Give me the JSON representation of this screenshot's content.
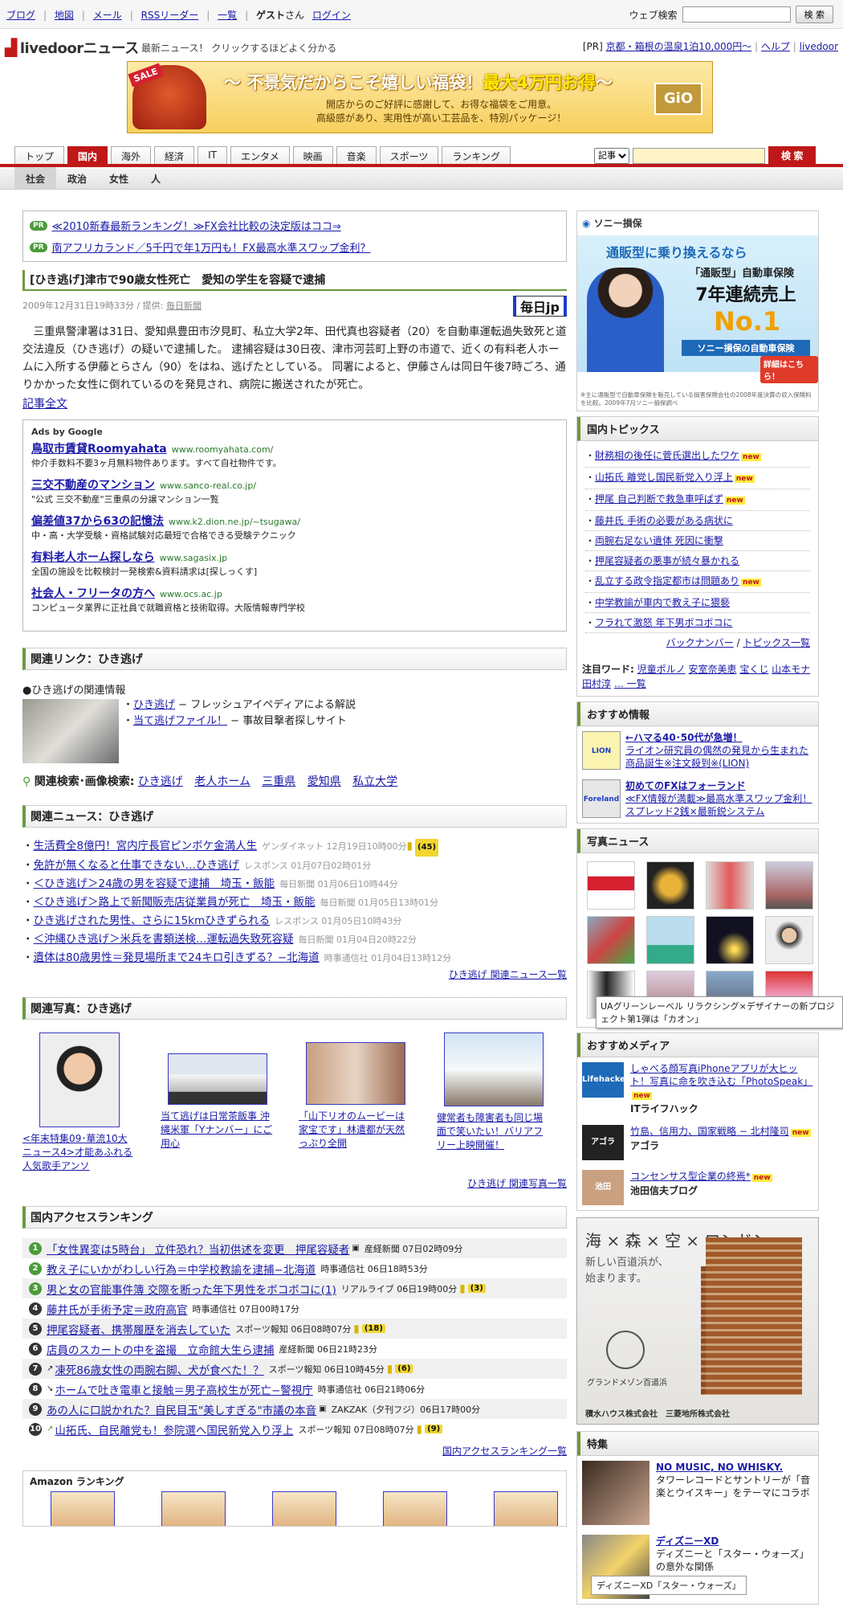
{
  "topbar": {
    "links": [
      "ブログ",
      "地図",
      "メール",
      "RSSリーダー",
      "一覧"
    ],
    "guest": "ゲスト",
    "san": "さん",
    "login": "ログイン",
    "websearch_label": "ウェブ検索",
    "websearch_button": "検 索"
  },
  "brand": {
    "logo": "livedoor",
    "logo_news": "ニュース",
    "tagline": "最新ニュース！ クリックするほどよく分かる",
    "pr_prefix": "[PR]",
    "pr_link": "京都・箱根の温泉1泊10,000円〜",
    "help": "ヘルプ",
    "livedoor": "livedoor"
  },
  "banner": {
    "sale": "SALE",
    "headline_pre": "〜 不景気だからこそ嬉しい福袋！",
    "headline_em": "最大4万円お得",
    "headline_post": "〜",
    "sub1": "開店からのご好評に感謝して、お得な福袋をご用意。",
    "sub2": "高級感があり、実用性が高い工芸品を、特別パッケージ！",
    "brand": "GiO"
  },
  "tabs": [
    "トップ",
    "国内",
    "海外",
    "経済",
    "IT",
    "エンタメ",
    "映画",
    "音楽",
    "スポーツ",
    "ランキング"
  ],
  "active_tab": "国内",
  "search": {
    "select": "記事",
    "button": "検 索"
  },
  "subtabs": [
    "社会",
    "政治",
    "女性",
    "人"
  ],
  "pr_links": [
    "≪2010新春最新ランキング！≫FX会社比較の決定版はココ⇒",
    "南アフリカランド／5千円で年1万円も！FX最高水準スワップ金利？"
  ],
  "pr_tag": "PR",
  "article": {
    "title": "[ひき逃げ]津市で90歳女性死亡　愛知の学生を容疑で逮捕",
    "date": "2009年12月31日19時33分 / 提供:",
    "provider": "毎日新聞",
    "logo": "毎日jp",
    "body": "三重県警津署は31日、愛知県豊田市汐見町、私立大学2年、田代真也容疑者（20）を自動車運転過失致死と道交法違反（ひき逃げ）の疑いで逮捕した。 逮捕容疑は30日夜、津市河芸町上野の市道で、近くの有料老人ホームに入所する伊藤とらさん（90）をはね、逃げたとしている。 同署によると、伊藤さんは同日午後7時ごろ、通りかかった女性に倒れているのを発見され、病院に搬送されたが死亡。",
    "more": "記事全文"
  },
  "ads": {
    "heading": "Ads by Google",
    "items": [
      {
        "title": "鳥取市賃貸Roomyahata",
        "url": "www.roomyahata.com/",
        "desc": "仲介手数料不要3ヶ月無料物件あります。すべて自社物件です。"
      },
      {
        "title": "三交不動産のマンション",
        "url": "www.sanco-real.co.jp/",
        "desc": "\"公式 三交不動産\"三重県の分譲マンション一覧"
      },
      {
        "title": "偏差値37から63の記憶法",
        "url": "www.k2.dion.ne.jp/~tsugawa/",
        "desc": "中・高・大学受験・資格試験対応最短で合格できる受験テクニック"
      },
      {
        "title": "有料老人ホーム探しなら",
        "url": "www.sagasix.jp",
        "desc": "全国の施設を比較検討一発検索&資料請求は[探しっくす]"
      },
      {
        "title": "社会人・フリータの方へ",
        "url": "www.ocs.ac.jp",
        "desc": "コンピュータ業界に正社員で就職資格と技術取得。大阪情報専門学校"
      }
    ]
  },
  "related_links": {
    "heading": "関連リンク：ひき逃げ",
    "info_title": "●ひき逃げの関連情報",
    "items": [
      {
        "link": "ひき逃げ",
        "desc": " − フレッシュアイペディアによる解説"
      },
      {
        "link": "当て逃げファイル！",
        "desc": " − 事故目撃者探しサイト"
      }
    ]
  },
  "keyword_search": {
    "label": "関連検索･画像検索:",
    "words": [
      "ひき逃げ",
      "老人ホーム",
      "三重県",
      "愛知県",
      "私立大学"
    ]
  },
  "related_news": {
    "heading": "関連ニュース：ひき逃げ",
    "items": [
      {
        "title": "生活費全8億円！宮内庁長官ピンボケ金満人生",
        "src": "ゲンダイネット 12月19日10時00分",
        "cmt": "(45)"
      },
      {
        "title": "免許が無くなると仕事できない…ひき逃げ",
        "src": "レスポンス 01月07日02時01分",
        "cmt": ""
      },
      {
        "title": "＜ひき逃げ＞24歳の男を容疑で逮捕　埼玉・飯能",
        "src": "毎日新聞 01月06日10時44分",
        "cmt": ""
      },
      {
        "title": "＜ひき逃げ＞路上で新聞販売店従業員が死亡　埼玉・飯能",
        "src": "毎日新聞 01月05日13時01分",
        "cmt": ""
      },
      {
        "title": "ひき逃げされた男性、さらに15kmひきずられる",
        "src": "レスポンス 01月05日10時43分",
        "cmt": ""
      },
      {
        "title": "＜沖縄ひき逃げ＞米兵を書類送検…運転過失致死容疑",
        "src": "毎日新聞 01月04日20時22分",
        "cmt": ""
      },
      {
        "title": "遺体は80歳男性＝発見場所まで24キロ引きずる？−北海道",
        "src": "時事通信社 01月04日13時12分",
        "cmt": ""
      }
    ],
    "more": "ひき逃げ 関連ニュース一覧"
  },
  "related_photos": {
    "heading": "関連写真：ひき逃げ",
    "items": [
      "<年末特集09･華流10大ニュース4>才能あふれる人気歌手アンソ",
      "当て逃げは日常茶飯事 沖縄米軍「Yナンバー」にご用心",
      "「山下リオのムービーは家宝です」林遣都が天然っぷり全開",
      "健常者も障害者も同じ場面で笑いたい！バリアフリー上映開催！"
    ],
    "more": "ひき逃げ 関連写真一覧"
  },
  "ranking": {
    "heading": "国内アクセスランキング",
    "items": [
      {
        "n": "1",
        "title": "「女性異変は5時台」 立件恐れ？当初供述を変更　押尾容疑者",
        "src": "産経新聞 07日02時09分",
        "cmt": ""
      },
      {
        "n": "2",
        "title": "教え子にいかがわしい行為＝中学校教諭を逮捕−北海道",
        "src": "時事通信社 06日18時53分",
        "cmt": ""
      },
      {
        "n": "3",
        "title": "男と女の官能事件簿 交際を断った年下男性をボコボコに(1)",
        "src": "リアルライブ 06日19時00分",
        "cmt": "(3)"
      },
      {
        "n": "4",
        "title": "藤井氏が手術予定＝政府高官",
        "src": "時事通信社 07日00時17分",
        "cmt": ""
      },
      {
        "n": "5",
        "title": "押尾容疑者、携帯履歴を消去していた",
        "src": "スポーツ報知 06日08時07分",
        "cmt": "(18)"
      },
      {
        "n": "6",
        "title": "店員のスカートの中を盗撮　立命館大生ら逮捕",
        "src": "産経新聞 06日21時23分",
        "cmt": ""
      },
      {
        "n": "7",
        "title": "凍死86歳女性の両腕右脚、犬が食べた！？",
        "src": "スポーツ報知 06日10時45分",
        "cmt": "(6)"
      },
      {
        "n": "8",
        "title": "ホームで吐き電車と接触＝男子高校生が死亡−警視庁",
        "src": "時事通信社 06日21時06分",
        "cmt": ""
      },
      {
        "n": "9",
        "title": "あの人に口説かれた？自民目玉\"美しすぎる\"市議の本音",
        "src": "ZAKZAK（夕刊フジ）06日17時00分",
        "cmt": ""
      },
      {
        "n": "10",
        "title": "山拓氏、自民離党も！参院選へ国民新党入り浮上",
        "src": "スポーツ報知 07日08時07分",
        "cmt": "(9)"
      }
    ],
    "more": "国内アクセスランキング一覧"
  },
  "amazon": {
    "heading": "Amazon ランキング"
  },
  "sony_ad": {
    "brand": "ソニー損保",
    "cap1": "通販型に乗り換えるなら",
    "cap2": "「通販型」自動車保険",
    "cap3": "7年連続売上",
    "no1": "No.1",
    "band": "ソニー損保の自動車保険",
    "detail": "詳細はこちら！",
    "fine": "※主に通販型で自動車保険を販売している損害保険会社の2008年度決算の収入保険料を比較。2009年7月ソニー損保調べ"
  },
  "topics": {
    "heading": "国内トピックス",
    "items": [
      {
        "t": "財務相の後任に菅氏選出したワケ",
        "new": true
      },
      {
        "t": "山拓氏 離党し国民新党入り浮上",
        "new": true
      },
      {
        "t": "押尾 自己判断で救急車呼ばず",
        "new": true
      },
      {
        "t": "藤井氏 手術の必要がある病状に",
        "new": false
      },
      {
        "t": "両腕右足ない遺体 死因に衝撃",
        "new": false
      },
      {
        "t": "押尾容疑者の悪事が続々暴かれる",
        "new": false
      },
      {
        "t": "乱立する政令指定都市は問題あり",
        "new": true
      },
      {
        "t": "中学教諭が車内で教え子に猥褻",
        "new": false
      },
      {
        "t": "フラれて激怒 年下男ボコボコに",
        "new": false
      }
    ],
    "new_label": "new",
    "backnumber": "バックナンバー",
    "list": "トピックス一覧",
    "attention_label": "注目ワード:",
    "attention": [
      "児童ポルノ",
      "安室奈美恵",
      "宝くじ",
      "山本モナ",
      "田村淳"
    ],
    "attention_more": "… 一覧"
  },
  "recommend": {
    "heading": "おすすめ情報",
    "items": [
      {
        "logo": "LION",
        "title": "←ハマる40･50代が急増！",
        "desc": "ライオン研究員の偶然の発見から生まれた商品誕生※注文殺到※(LION)"
      },
      {
        "logo": "Foreland",
        "title": "初めてのFXはフォーランド",
        "desc": "≪FX情報が満載≫最高水準スワップ金利！スプレッド2銭×最新鋭システム"
      }
    ]
  },
  "photo_news": {
    "heading": "写真ニュース",
    "count": 12
  },
  "tooltip": "UAグリーンレーベル リラクシング×デザイナーの新プロジェクト第1弾は「カオン」",
  "media": {
    "heading": "おすすめメディア",
    "items": [
      {
        "logo": "Lifehacker",
        "title": "しゃべる顔写真iPhoneアプリが大ヒット！写真に命を吹き込む「PhotoSpeak」",
        "name": "ITライフハック",
        "new": true
      },
      {
        "logo": "アゴラ",
        "title": "竹島、信用力、国家戦略 − 北村隆司",
        "name": "アゴラ",
        "new": true
      },
      {
        "logo": "池田",
        "title": "コンセンサス型企業の終焉*",
        "name": "池田信夫ブログ",
        "new": true
      }
    ]
  },
  "london_ad": {
    "t1": "海 × 森 × 空 × ロンドン",
    "t2a": "新しい百道浜が、",
    "t2b": "始まります。",
    "name": "グランドメゾン百道浜",
    "bottom": "積水ハウス株式会社　三菱地所株式会社"
  },
  "feature": {
    "heading": "特集",
    "items": [
      {
        "title": "NO MUSIC, NO WHISKY.",
        "desc": "タワーレコードとサントリーが「音楽とウイスキー」をテーマにコラボ"
      },
      {
        "title": "ディズニーXD",
        "desc": "ディズニーと「スター・ウォーズ」の意外な関係"
      }
    ]
  },
  "tooltip2": "ディズニーXD「スター・ウォーズ」"
}
